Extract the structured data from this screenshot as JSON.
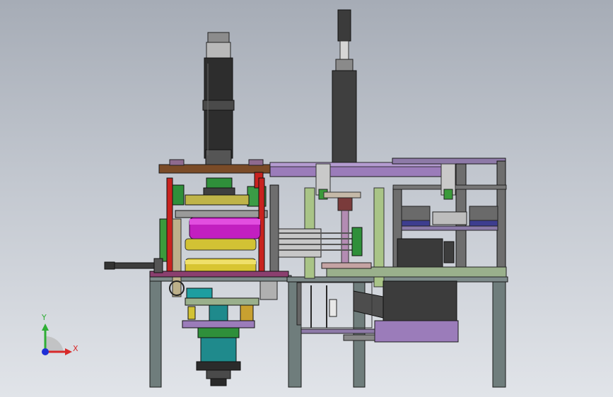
{
  "viewport": {
    "background_top": "#a6acb6",
    "background_bottom": "#e1e4e9"
  },
  "model": {
    "description_icon": "cad-assembly-machine",
    "colors": {
      "frame": "#6e7b7b",
      "purple": "#9a7bb8",
      "magenta": "#c21fc0",
      "yellow": "#d2c234",
      "green": "#2e8a3a",
      "teal": "#1f8a8c",
      "dark": "#3a3a3a",
      "olive": "#a8c07c",
      "brown": "#7a4a25",
      "red": "#c8231f"
    }
  },
  "triad": {
    "y_label": "Y",
    "x_label": "X",
    "y_color": "#2fae35",
    "x_color": "#d82a2a",
    "z_color": "#1f2fd6"
  }
}
